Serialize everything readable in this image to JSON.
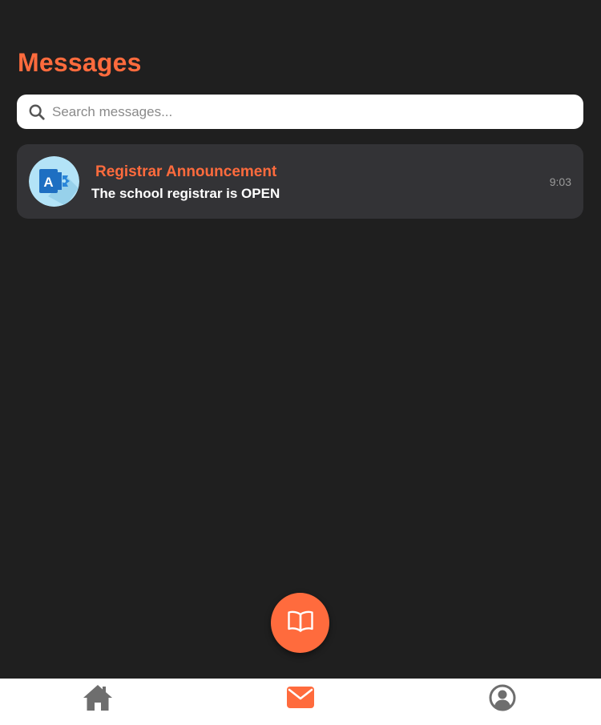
{
  "header": {
    "title": "Messages"
  },
  "search": {
    "placeholder": "Search messages...",
    "value": ""
  },
  "messages": [
    {
      "sender": "Registrar Announcement",
      "preview": "The school registrar is OPEN",
      "time": "9:03",
      "avatar_icon": "access-app-icon"
    }
  ],
  "fab": {
    "icon": "book-open-icon"
  },
  "bottom_nav": {
    "items": [
      {
        "id": "home",
        "icon": "home-icon",
        "active": false
      },
      {
        "id": "messages",
        "icon": "envelope-icon",
        "active": true
      },
      {
        "id": "profile",
        "icon": "user-circle-icon",
        "active": false
      }
    ]
  },
  "colors": {
    "background": "#1f1f1f",
    "accent": "#ff6b3d",
    "card": "#333336",
    "nav_background": "#ffffff",
    "nav_inactive": "#6e6e6e"
  }
}
